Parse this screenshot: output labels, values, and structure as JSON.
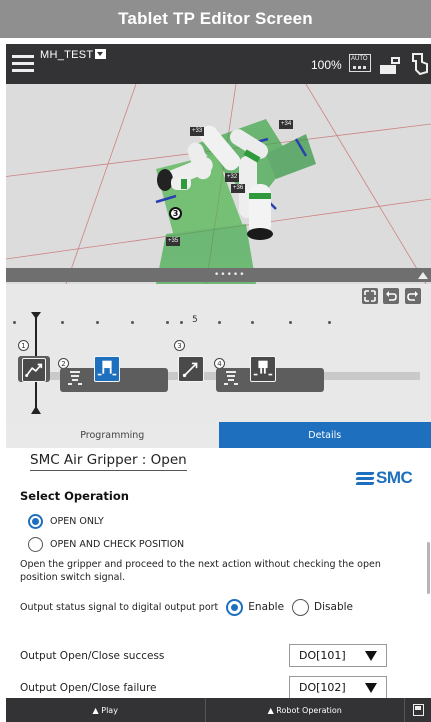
{
  "banner": {
    "title": "Tablet TP Editor Screen"
  },
  "topbar": {
    "program_name": "MH_TEST",
    "speed": "100%",
    "mode_icon_text": "AUTO",
    "icons": [
      "menu-icon",
      "dropdown-icon",
      "auto-mode-icon",
      "teach-pendant-icon",
      "hand-guide-icon"
    ]
  },
  "viewport": {
    "labels": {
      "j33": "+33",
      "j34": "+34",
      "j32": "+32",
      "j36": "+36",
      "j35": "+35"
    },
    "waypoint": "3",
    "splitter_dots": "•••••"
  },
  "timeline": {
    "ruler_number": "5",
    "nodes": [
      "1",
      "2",
      "3",
      "4"
    ],
    "icons": [
      "motion-icon",
      "gripper-open-icon",
      "motion-icon",
      "gripper-close-icon"
    ]
  },
  "tabs": {
    "programming": "Programming",
    "details": "Details",
    "active": "Details"
  },
  "details": {
    "title": "SMC Air Gripper : Open",
    "logo_text": "SMC",
    "section_title": "Select Operation",
    "options": [
      {
        "label": "OPEN ONLY",
        "checked": true
      },
      {
        "label": "OPEN AND CHECK POSITION",
        "checked": false
      }
    ],
    "description": "Open the gripper and proceed to the next action without checking the open position switch signal.",
    "output_status": {
      "label": "Output status signal to digital output port",
      "enable": "Enable",
      "disable": "Disable",
      "selected": "Enable"
    },
    "fields": [
      {
        "label": "Output Open/Close success",
        "value": "DO[101]"
      },
      {
        "label": "Output Open/Close failure",
        "value": "DO[102]"
      }
    ]
  },
  "bottom_bar": {
    "play": "▲ Play",
    "robot_operation": "▲ Robot Operation"
  },
  "colors": {
    "accent": "#1f6fbf",
    "topbar": "#333335",
    "banner": "#8f8f8f"
  }
}
